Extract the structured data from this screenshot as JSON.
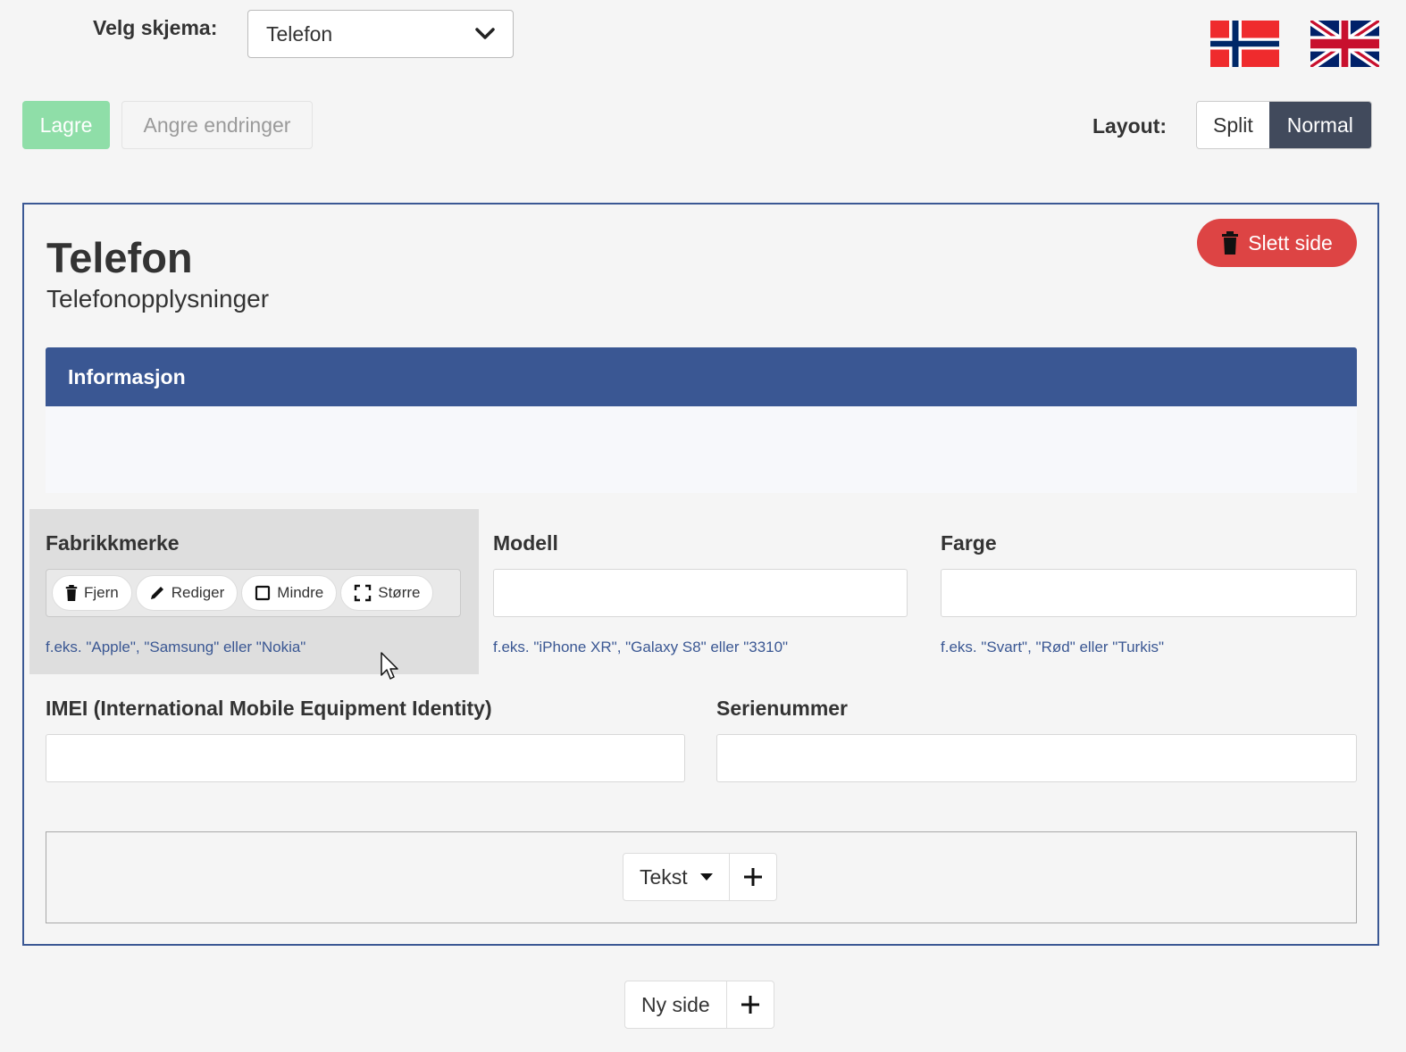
{
  "header": {
    "schema_label": "Velg skjema:",
    "schema_value": "Telefon",
    "languages": [
      "norwegian-flag-icon",
      "english-flag-icon"
    ]
  },
  "toolbar": {
    "save_label": "Lagre",
    "undo_label": "Angre endringer",
    "layout_label": "Layout:",
    "layout_options": [
      "Split",
      "Normal"
    ],
    "layout_selected": "Normal"
  },
  "page": {
    "title": "Telefon",
    "subtitle": "Telefonopplysninger",
    "delete_label": "Slett side",
    "section_title": "Informasjon",
    "fields": [
      {
        "label": "Fabrikkmerke",
        "value": "",
        "hint": "f.eks. \"Apple\", \"Samsung\" eller \"Nokia\""
      },
      {
        "label": "Modell",
        "value": "",
        "hint": "f.eks. \"iPhone XR\", \"Galaxy S8\" eller \"3310\""
      },
      {
        "label": "Farge",
        "value": "",
        "hint": "f.eks. \"Svart\", \"Rød\" eller \"Turkis\""
      },
      {
        "label": "IMEI (International Mobile Equipment Identity)",
        "value": ""
      },
      {
        "label": "Serienummer",
        "value": ""
      }
    ],
    "field_tools": [
      "Fjern",
      "Rediger",
      "Mindre",
      "Større"
    ],
    "add_field_type": "Tekst"
  },
  "new_page_label": "Ny side",
  "colors": {
    "primary": "#3a5793",
    "success": "#8fdea8",
    "danger": "#dd4444",
    "active_toggle": "#414a5c"
  }
}
